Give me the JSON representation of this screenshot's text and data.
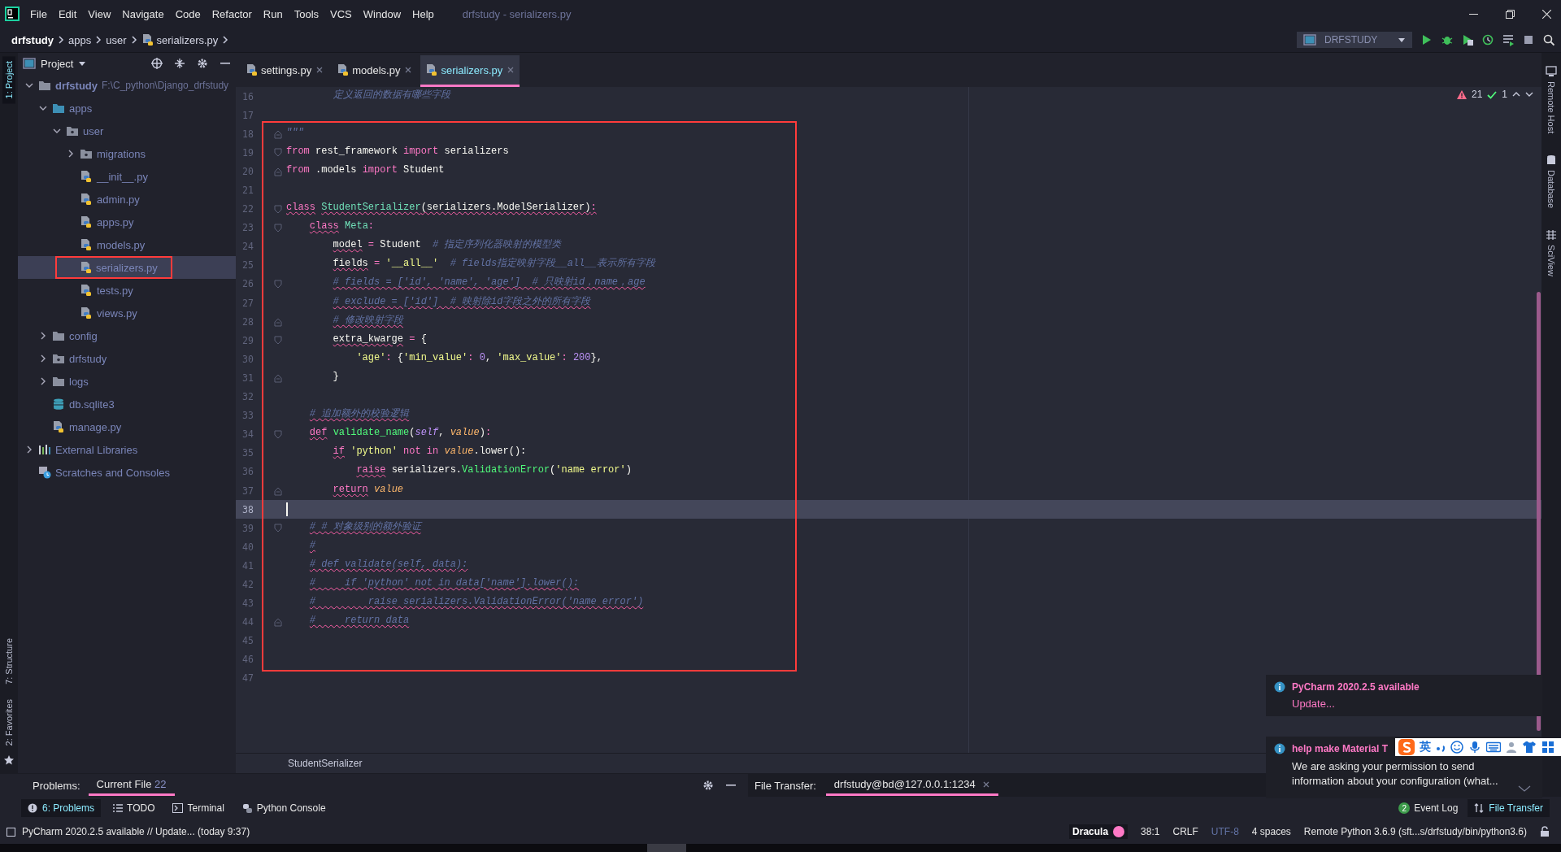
{
  "menu_bar": {
    "items": [
      "File",
      "Edit",
      "View",
      "Navigate",
      "Code",
      "Refactor",
      "Run",
      "Tools",
      "VCS",
      "Window",
      "Help"
    ],
    "title": "drfstudy - serializers.py"
  },
  "nav_bar": {
    "breadcrumbs": [
      {
        "label": "drfstudy",
        "kind": "project"
      },
      {
        "label": "apps",
        "kind": "folder"
      },
      {
        "label": "user",
        "kind": "folder"
      },
      {
        "label": "serializers.py",
        "kind": "file"
      }
    ],
    "run_config": "DRFSTUDY"
  },
  "left_stripe": {
    "top": [
      {
        "label": "1: Project",
        "selected": true
      }
    ],
    "bottom": [
      {
        "label": "7: Structure",
        "selected": false
      },
      {
        "label": "2: Favorites",
        "selected": false
      }
    ]
  },
  "right_stripe": [
    {
      "label": "Remote Host",
      "kind": "host"
    },
    {
      "label": "Database",
      "kind": "database"
    },
    {
      "label": "SciView",
      "kind": "sciview"
    }
  ],
  "project_panel": {
    "title": "Project",
    "tree": [
      {
        "label": "drfstudy",
        "path": "F:\\C_python\\Django_drfstudy",
        "kind": "folder",
        "expanded": true,
        "selected": false,
        "children": [
          {
            "label": "apps",
            "kind": "source",
            "expanded": true,
            "selected": false,
            "children": [
              {
                "label": "user",
                "kind": "package",
                "expanded": true,
                "selected": false,
                "children": [
                  {
                    "label": "migrations",
                    "kind": "package",
                    "expanded": false,
                    "selected": false
                  },
                  {
                    "label": "__init__.py",
                    "kind": "python",
                    "selected": false
                  },
                  {
                    "label": "admin.py",
                    "kind": "python",
                    "selected": false
                  },
                  {
                    "label": "apps.py",
                    "kind": "python",
                    "selected": false
                  },
                  {
                    "label": "models.py",
                    "kind": "python",
                    "selected": false
                  },
                  {
                    "label": "serializers.py",
                    "kind": "python",
                    "selected": true,
                    "framed": true
                  },
                  {
                    "label": "tests.py",
                    "kind": "python",
                    "selected": false
                  },
                  {
                    "label": "views.py",
                    "kind": "python",
                    "selected": false
                  }
                ]
              }
            ]
          },
          {
            "label": "config",
            "kind": "folder",
            "expanded": false,
            "selected": false
          },
          {
            "label": "drfstudy",
            "kind": "package",
            "expanded": false,
            "selected": false
          },
          {
            "label": "logs",
            "kind": "folder",
            "expanded": false,
            "selected": false
          },
          {
            "label": "db.sqlite3",
            "kind": "database",
            "selected": false
          },
          {
            "label": "manage.py",
            "kind": "python",
            "selected": false
          }
        ]
      },
      {
        "label": "External Libraries",
        "kind": "libraries",
        "expanded": false,
        "selected": false
      },
      {
        "label": "Scratches and Consoles",
        "kind": "scratches",
        "selected": false
      }
    ]
  },
  "editor": {
    "tabs": [
      {
        "label": "settings.py",
        "selected": false
      },
      {
        "label": "models.py",
        "selected": false
      },
      {
        "label": "serializers.py",
        "selected": true
      }
    ],
    "inspections": {
      "warnings": "21",
      "ok": "1"
    },
    "breadcrumb": "StudentSerializer",
    "line_groups": [
      {
        "framed": false,
        "lines": [
          {
            "number": "16",
            "kind": "code",
            "current": false,
            "tokens": [
              {
                "text": "        定义返回的数据有哪些字段",
                "kind": "doc",
                "squiggly": false
              }
            ]
          },
          {
            "number": "17",
            "kind": "code",
            "current": false
          }
        ]
      },
      {
        "framed": true,
        "lines": [
          {
            "number": "18",
            "kind": "fold_end",
            "current": false,
            "tokens": [
              {
                "text": "\"\"\"",
                "kind": "doc",
                "squiggly": false
              }
            ]
          },
          {
            "number": "19",
            "kind": "fold_start",
            "current": false,
            "tokens": [
              {
                "text": "from",
                "kind": "kw",
                "squiggly": false
              },
              {
                "text": " rest_framework ",
                "kind": "plain",
                "squiggly": false
              },
              {
                "text": "import",
                "kind": "kw",
                "squiggly": false
              },
              {
                "text": " serializers",
                "kind": "plain",
                "squiggly": false
              }
            ]
          },
          {
            "number": "20",
            "kind": "fold_end",
            "current": false,
            "tokens": [
              {
                "text": "from",
                "kind": "kw",
                "squiggly": false
              },
              {
                "text": " .models ",
                "kind": "plain",
                "squiggly": false
              },
              {
                "text": "import",
                "kind": "kw",
                "squiggly": false
              },
              {
                "text": " Student",
                "kind": "plain",
                "squiggly": false
              }
            ]
          },
          {
            "number": "21",
            "kind": "code",
            "current": false
          },
          {
            "number": "22",
            "kind": "fold_start",
            "current": false,
            "tokens": [
              {
                "text": "class",
                "kind": "kw",
                "squiggly": true
              },
              {
                "text": " StudentSerializer",
                "kind": "cls",
                "squiggly": true
              },
              {
                "text": "(serializers.ModelSerializer)",
                "kind": "plain",
                "squiggly": true
              },
              {
                "text": ":",
                "kind": "op",
                "squiggly": true
              }
            ]
          },
          {
            "number": "23",
            "kind": "fold_start",
            "current": false,
            "tokens": [
              {
                "text": "    class",
                "kind": "kw",
                "squiggly": true
              },
              {
                "text": " Meta",
                "kind": "cls",
                "squiggly": false
              },
              {
                "text": ":",
                "kind": "op",
                "squiggly": false
              }
            ]
          },
          {
            "number": "24",
            "kind": "code",
            "current": false,
            "tokens": [
              {
                "text": "        model",
                "kind": "plain",
                "squiggly": true
              },
              {
                "text": " = ",
                "kind": "op",
                "squiggly": false
              },
              {
                "text": "Student",
                "kind": "plain",
                "squiggly": false
              },
              {
                "text": "  # 指定序列化器映射的模型类",
                "kind": "cmt",
                "squiggly": false
              }
            ]
          },
          {
            "number": "25",
            "kind": "code",
            "current": false,
            "tokens": [
              {
                "text": "        fields",
                "kind": "plain",
                "squiggly": true
              },
              {
                "text": " = ",
                "kind": "op",
                "squiggly": false
              },
              {
                "text": "'__all__'",
                "kind": "str",
                "squiggly": false
              },
              {
                "text": "  # fields指定映射字段__all__表示所有字段",
                "kind": "cmt",
                "squiggly": false
              }
            ]
          },
          {
            "number": "26",
            "kind": "fold_start",
            "current": false,
            "tokens": [
              {
                "text": "        # fields = ['id', 'name', 'age']  # 只映射id，name，age",
                "kind": "cmt",
                "squiggly": true
              }
            ]
          },
          {
            "number": "27",
            "kind": "code",
            "current": false,
            "tokens": [
              {
                "text": "        # exclude = ['id']  # 映射除id字段之外的所有字段",
                "kind": "cmt",
                "squiggly": true
              }
            ]
          },
          {
            "number": "28",
            "kind": "fold_end",
            "current": false,
            "tokens": [
              {
                "text": "        # 修改映射字段",
                "kind": "cmt",
                "squiggly": true
              }
            ]
          },
          {
            "number": "29",
            "kind": "fold_start",
            "current": false,
            "tokens": [
              {
                "text": "        extra_kwarge",
                "kind": "plain",
                "squiggly": true
              },
              {
                "text": " = ",
                "kind": "op",
                "squiggly": false
              },
              {
                "text": "{",
                "kind": "plain",
                "squiggly": false
              }
            ]
          },
          {
            "number": "30",
            "kind": "code",
            "current": false,
            "tokens": [
              {
                "text": "            'age'",
                "kind": "str",
                "squiggly": false
              },
              {
                "text": ": ",
                "kind": "op",
                "squiggly": false
              },
              {
                "text": "{",
                "kind": "plain",
                "squiggly": false
              },
              {
                "text": "'min_value'",
                "kind": "str",
                "squiggly": false
              },
              {
                "text": ": ",
                "kind": "op",
                "squiggly": false
              },
              {
                "text": "0",
                "kind": "num",
                "squiggly": false
              },
              {
                "text": ", ",
                "kind": "plain",
                "squiggly": false
              },
              {
                "text": "'max_value'",
                "kind": "str",
                "squiggly": false
              },
              {
                "text": ": ",
                "kind": "op",
                "squiggly": false
              },
              {
                "text": "200",
                "kind": "num",
                "squiggly": false
              },
              {
                "text": "},",
                "kind": "plain",
                "squiggly": false
              }
            ]
          },
          {
            "number": "31",
            "kind": "fold_end",
            "current": false,
            "tokens": [
              {
                "text": "        }",
                "kind": "plain",
                "squiggly": false
              }
            ]
          },
          {
            "number": "32",
            "kind": "code",
            "current": false
          },
          {
            "number": "33",
            "kind": "code",
            "current": false,
            "tokens": [
              {
                "text": "    # 追加额外的校验逻辑",
                "kind": "cmt",
                "squiggly": true
              }
            ]
          },
          {
            "number": "34",
            "kind": "fold_start",
            "current": false,
            "tokens": [
              {
                "text": "    def",
                "kind": "kw",
                "squiggly": true
              },
              {
                "text": " validate_name",
                "kind": "fn",
                "squiggly": false
              },
              {
                "text": "(",
                "kind": "plain",
                "squiggly": false
              },
              {
                "text": "self",
                "kind": "self",
                "squiggly": false
              },
              {
                "text": ", ",
                "kind": "plain",
                "squiggly": false
              },
              {
                "text": "value",
                "kind": "param",
                "squiggly": false
              },
              {
                "text": ")",
                "kind": "plain",
                "squiggly": false
              },
              {
                "text": ":",
                "kind": "op",
                "squiggly": false
              }
            ]
          },
          {
            "number": "35",
            "kind": "code",
            "current": false,
            "tokens": [
              {
                "text": "        if",
                "kind": "kw",
                "squiggly": true
              },
              {
                "text": " 'python'",
                "kind": "str",
                "squiggly": false
              },
              {
                "text": " not in ",
                "kind": "kw",
                "squiggly": false
              },
              {
                "text": "value",
                "kind": "param",
                "squiggly": false
              },
              {
                "text": ".lower():",
                "kind": "plain",
                "squiggly": false
              }
            ]
          },
          {
            "number": "36",
            "kind": "code",
            "current": false,
            "tokens": [
              {
                "text": "            raise",
                "kind": "kw",
                "squiggly": true
              },
              {
                "text": " serializers.",
                "kind": "plain",
                "squiggly": false
              },
              {
                "text": "ValidationError",
                "kind": "fn",
                "squiggly": false
              },
              {
                "text": "(",
                "kind": "plain",
                "squiggly": false
              },
              {
                "text": "'name error'",
                "kind": "str",
                "squiggly": false
              },
              {
                "text": ")",
                "kind": "plain",
                "squiggly": false
              }
            ]
          },
          {
            "number": "37",
            "kind": "fold_end",
            "current": false,
            "tokens": [
              {
                "text": "        return",
                "kind": "kw",
                "squiggly": true
              },
              {
                "text": " value",
                "kind": "param",
                "squiggly": false
              }
            ]
          },
          {
            "number": "38",
            "kind": "code",
            "current": true
          },
          {
            "number": "39",
            "kind": "fold_start",
            "current": false,
            "tokens": [
              {
                "text": "    # # 对象级别的额外验证",
                "kind": "cmt",
                "squiggly": true
              }
            ]
          },
          {
            "number": "40",
            "kind": "code",
            "current": false,
            "tokens": [
              {
                "text": "    #",
                "kind": "cmt",
                "squiggly": true
              }
            ]
          },
          {
            "number": "41",
            "kind": "code",
            "current": false,
            "tokens": [
              {
                "text": "    # def validate(self, data):",
                "kind": "cmt",
                "squiggly": true
              }
            ]
          },
          {
            "number": "42",
            "kind": "code",
            "current": false,
            "tokens": [
              {
                "text": "    #     if 'python' not in data['name'].lower():",
                "kind": "cmt",
                "squiggly": true
              }
            ]
          },
          {
            "number": "43",
            "kind": "code",
            "current": false,
            "tokens": [
              {
                "text": "    #         raise serializers.ValidationError('name error')",
                "kind": "cmt",
                "squiggly": true
              }
            ]
          },
          {
            "number": "44",
            "kind": "fold_end",
            "current": false,
            "tokens": [
              {
                "text": "    #     return data",
                "kind": "cmt",
                "squiggly": true
              }
            ]
          },
          {
            "number": "45",
            "kind": "code",
            "current": false
          },
          {
            "number": "46",
            "kind": "code",
            "current": false
          }
        ]
      },
      {
        "framed": false,
        "lines": [
          {
            "number": "47",
            "kind": "code",
            "current": false
          }
        ]
      }
    ]
  },
  "problems_bar": {
    "title": "Problems:",
    "tabs": [
      {
        "label": "Current File",
        "count": "22",
        "selected": true
      }
    ]
  },
  "file_transfer_bar": {
    "title": "File Transfer:",
    "tabs": [
      {
        "label": "drfstudy@bd@127.0.0.1:1234",
        "selected": true
      }
    ]
  },
  "tool_tabs": {
    "left": [
      {
        "label": "6: Problems",
        "kind": "problems",
        "selected": true
      },
      {
        "label": "TODO",
        "kind": "todo",
        "selected": false
      },
      {
        "label": "Terminal",
        "kind": "terminal",
        "selected": false
      },
      {
        "label": "Python Console",
        "kind": "console",
        "selected": false
      }
    ],
    "right": [
      {
        "label": "Event Log",
        "kind": "log",
        "badge": "2",
        "selected": false
      },
      {
        "label": "File Transfer",
        "kind": "transfer",
        "selected": true
      }
    ]
  },
  "notifications": [
    {
      "title": "PyCharm 2020.2.5 available",
      "link": "Update..."
    },
    {
      "title": "help make Material T",
      "body": "We are asking your permission to send information about your configuration (what..."
    }
  ],
  "ime_toolbar": {
    "mode": "英"
  },
  "status_bar": {
    "message": "PyCharm 2020.2.5 available // Update... (today 9:37)",
    "theme": "Dracula",
    "items": [
      {
        "text": "38:1",
        "dimmed": false
      },
      {
        "text": "CRLF",
        "dimmed": false
      },
      {
        "text": "UTF-8",
        "dimmed": true
      },
      {
        "text": "4 spaces",
        "dimmed": false
      },
      {
        "text": "Remote Python 3.6.9 (sft...s/drfstudy/bin/python3.6)",
        "dimmed": false
      }
    ]
  }
}
